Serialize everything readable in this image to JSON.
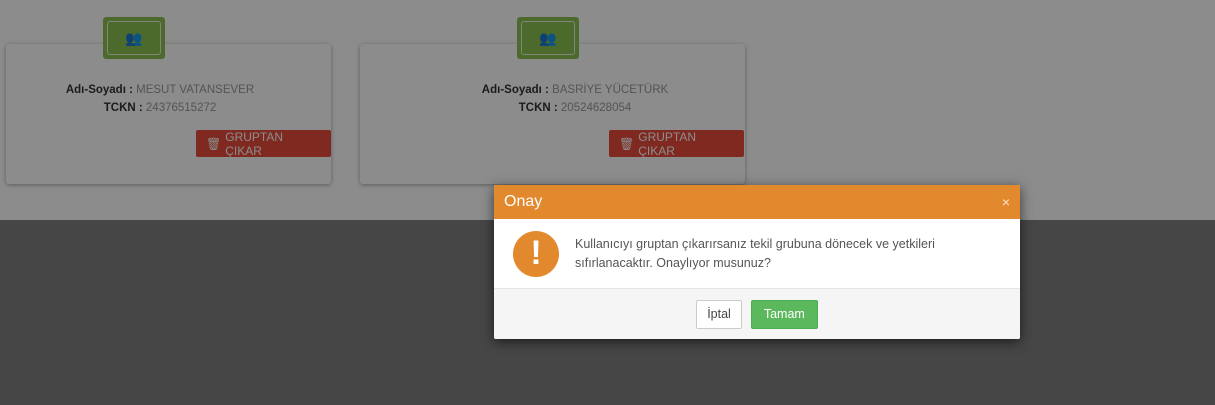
{
  "members": [
    {
      "name_label": "Adı-Soyadı :",
      "name": "MESUT VATANSEVER",
      "tckn_label": "TCKN :",
      "tckn": "24376515272",
      "remove_label": "GRUPTAN ÇIKAR"
    },
    {
      "name_label": "Adı-Soyadı :",
      "name": "BASRİYE YÜCETÜRK",
      "tckn_label": "TCKN :",
      "tckn": "20524628054",
      "remove_label": "GRUPTAN ÇIKAR"
    }
  ],
  "modal": {
    "title": "Onay",
    "close": "×",
    "icon": "!",
    "message": "Kullanıcıyı gruptan çıkarırsanız tekil grubuna dönecek ve yetkileri sıfırlanacaktır. Onaylıyor musunuz?",
    "cancel_label": "İptal",
    "ok_label": "Tamam"
  },
  "colors": {
    "header": "#e2892e",
    "ok_button": "#5cb85c",
    "remove_button": "#e74c3c",
    "avatar": "#8cc152"
  },
  "icons": {
    "avatar": "users-icon",
    "remove": "trash-icon",
    "warning": "exclamation-icon"
  }
}
